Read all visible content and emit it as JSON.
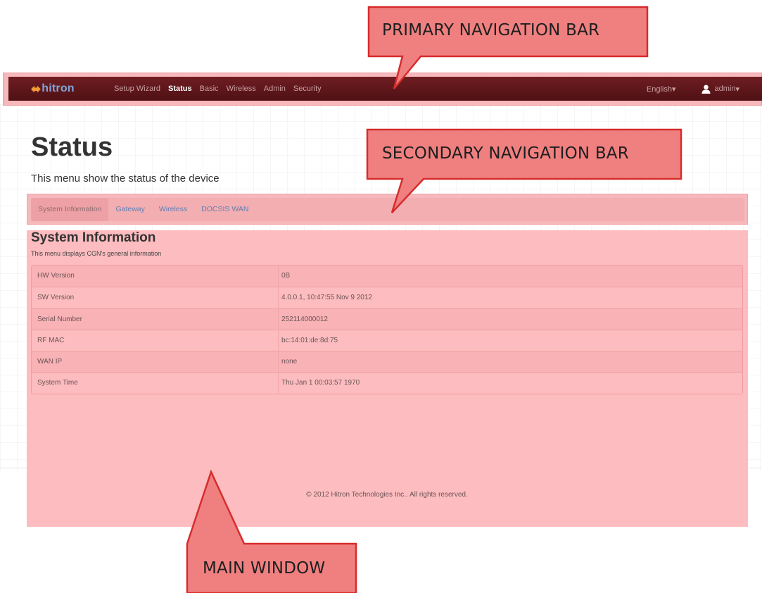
{
  "navbar": {
    "brand": "hitron",
    "links": [
      "Setup Wizard",
      "Status",
      "Basic",
      "Wireless",
      "Admin",
      "Security"
    ],
    "active_link": "Status",
    "language": "English",
    "user": "admin"
  },
  "page": {
    "title": "Status",
    "subtitle": "This menu show the status of the device"
  },
  "subnav": {
    "tabs": [
      "System Information",
      "Gateway",
      "Wireless",
      "DOCSIS WAN"
    ],
    "active_tab": "System Information"
  },
  "main": {
    "section_title": "System Information",
    "section_desc": "This menu displays CGN's general information",
    "rows": [
      {
        "key": "HW Version",
        "value": "0B"
      },
      {
        "key": "SW Version",
        "value": "4.0.0.1, 10:47:55 Nov 9 2012"
      },
      {
        "key": "Serial Number",
        "value": "252114000012"
      },
      {
        "key": "RF MAC",
        "value": "bc:14:01:de:8d:75"
      },
      {
        "key": "WAN IP",
        "value": "none"
      },
      {
        "key": "System Time",
        "value": "Thu Jan 1 00:03:57 1970"
      }
    ]
  },
  "footer": "© 2012 Hitron Technologies Inc.. All rights reserved.",
  "callouts": {
    "primary": "PRIMARY NAVIGATION BAR",
    "secondary": "SECONDARY NAVIGATION BAR",
    "main": "MAIN WINDOW"
  },
  "colors": {
    "navbar": "#5e171b",
    "highlight": "#fdbcbf",
    "callout_fill": "#f08080",
    "callout_border": "#d62c2c",
    "link": "#5f7fb3"
  },
  "icons": {
    "brand": "hitron-logo-icon",
    "user": "user-icon",
    "caret": "caret-down-icon"
  }
}
